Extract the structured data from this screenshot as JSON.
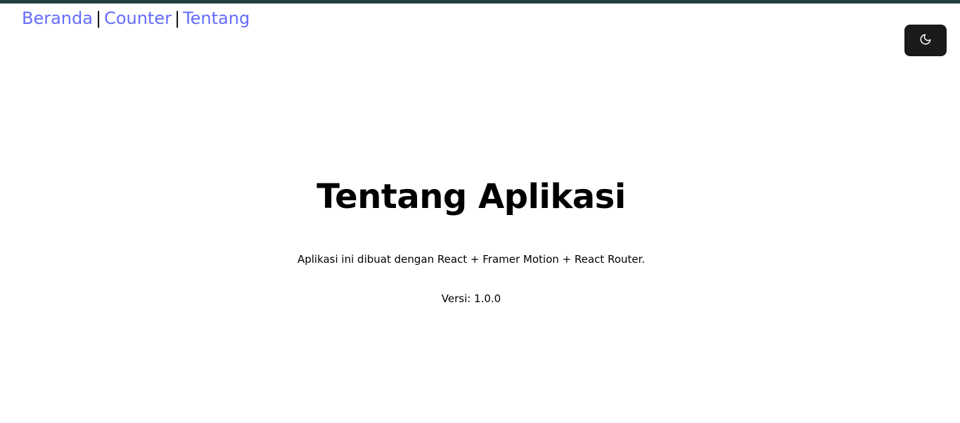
{
  "nav": {
    "links": [
      "Beranda",
      "Counter",
      "Tentang"
    ],
    "separator": "|"
  },
  "theme_toggle": {
    "icon": "moon-icon"
  },
  "main": {
    "title": "Tentang Aplikasi",
    "description": "Aplikasi ini dibuat dengan React + Framer Motion + React Router.",
    "version": "Versi: 1.0.0"
  },
  "colors": {
    "link": "#646cff",
    "top_bar": "#24403c",
    "toggle_bg": "#1a1a1a"
  }
}
